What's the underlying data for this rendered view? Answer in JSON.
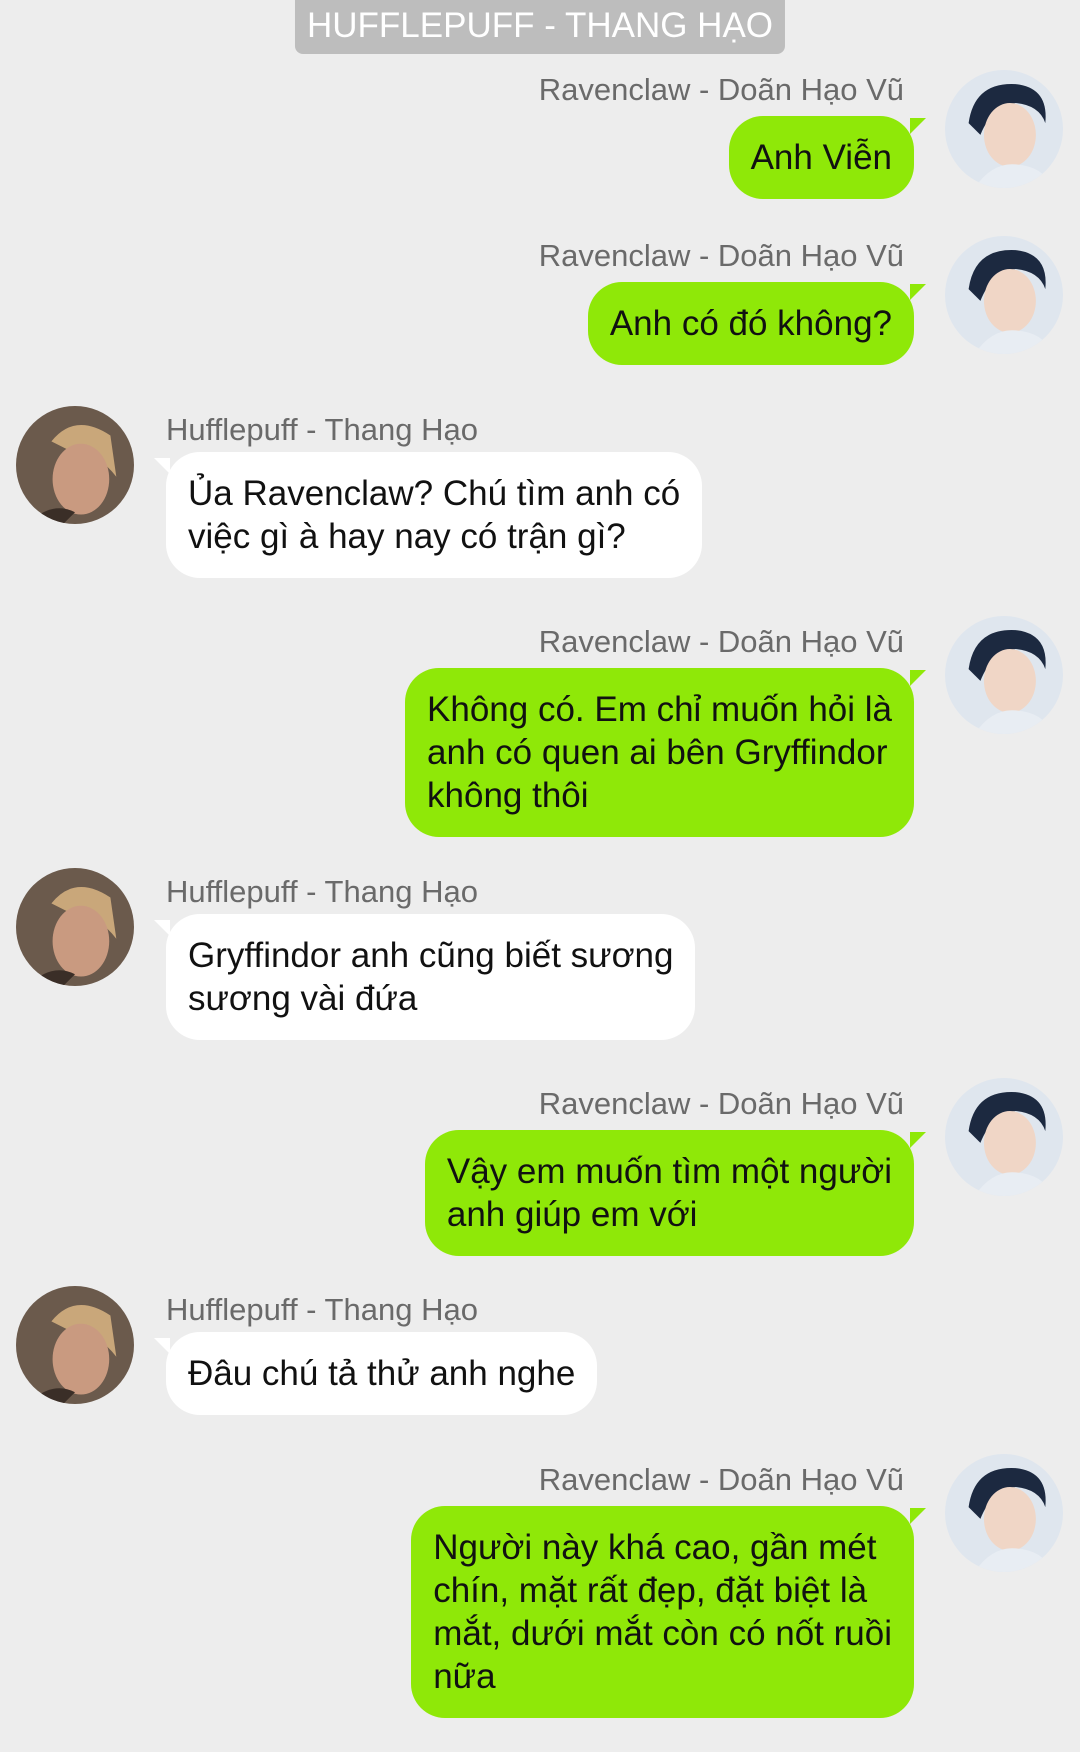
{
  "header": {
    "title": "HUFFLEPUFF - THANG HẠO"
  },
  "messages": [
    {
      "sender": "Ravenclaw - Doãn Hạo Vũ",
      "side": "right",
      "lines": [
        "Anh Viễn"
      ]
    },
    {
      "sender": "Ravenclaw - Doãn Hạo Vũ",
      "side": "right",
      "lines": [
        "Anh có đó không?"
      ]
    },
    {
      "sender": "Hufflepuff - Thang Hạo",
      "side": "left",
      "lines": [
        "Ủa Ravenclaw? Chú tìm anh có",
        "việc gì à hay nay có trận gì?"
      ]
    },
    {
      "sender": "Ravenclaw - Doãn Hạo Vũ",
      "side": "right",
      "lines": [
        "Không có. Em chỉ muốn hỏi là",
        "anh có quen ai bên Gryffindor",
        "không thôi"
      ]
    },
    {
      "sender": "Hufflepuff - Thang Hạo",
      "side": "left",
      "lines": [
        "Gryffindor anh cũng biết sương",
        "sương vài đứa"
      ]
    },
    {
      "sender": "Ravenclaw - Doãn Hạo Vũ",
      "side": "right",
      "lines": [
        "Vậy em muốn tìm một người",
        "anh giúp em với"
      ]
    },
    {
      "sender": "Hufflepuff - Thang Hạo",
      "side": "left",
      "lines": [
        "Đâu chú tả thử anh nghe"
      ]
    },
    {
      "sender": "Ravenclaw - Doãn Hạo Vũ",
      "side": "right",
      "lines": [
        "Người này khá cao, gần mét",
        "chín, mặt rất đẹp, đặt biệt là",
        "mắt, dưới mắt còn có nốt ruồi",
        "nữa"
      ]
    }
  ],
  "colors": {
    "background": "#ededed",
    "sent_bubble": "#8fe808",
    "received_bubble": "#ffffff",
    "header_bg": "#bdbdbd"
  },
  "icons": {
    "ravenclaw_avatar": "avatar-ravenclaw-icon",
    "hufflepuff_avatar": "avatar-hufflepuff-icon"
  }
}
